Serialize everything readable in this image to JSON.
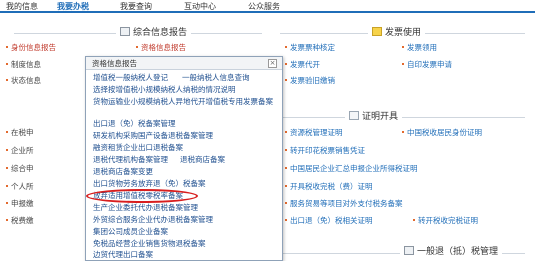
{
  "topnav": {
    "items": [
      {
        "label": "我的信息",
        "active": false
      },
      {
        "label": "我要办税",
        "active": true
      },
      {
        "label": "我要查询",
        "active": false
      },
      {
        "label": "互动中心",
        "active": false
      },
      {
        "label": "公众服务",
        "active": false
      }
    ]
  },
  "sections": {
    "comprehensive": {
      "title": "综合信息报告"
    },
    "invoice": {
      "title": "发票使用"
    },
    "certificate": {
      "title": "证明开具"
    },
    "general": {
      "title": "一般退（抵）税管理"
    }
  },
  "left_items": [
    "身份信息报告",
    "制度信息",
    "状态信息",
    "在税申",
    "企业所",
    "综合申",
    "个人所",
    "申报缴",
    "税费缴"
  ],
  "comprehensive_items": [
    "资格信息报告"
  ],
  "invoice_items": {
    "col1": [
      "发票票种核定",
      "发票代开",
      "发票验旧缴销"
    ],
    "col2": [
      "发票领用",
      "自印发票申请"
    ]
  },
  "right_items": {
    "col1": [
      "资源税管理证明",
      "转开印花税票销售凭证",
      "开具税收完税（费）证明",
      "服务贸易等项目对外支付税务备案",
      "出口退（免）税相关证明"
    ],
    "col2": [
      "中国税收居民身份证明",
      "转开税收完税证明"
    ],
    "full": [
      "中国居民企业汇总申报企业所得税证明"
    ]
  },
  "popup": {
    "title": "资格信息报告",
    "close": "×",
    "items": [
      "增值税一般纳税人登记",
      "一般纳税人信息查询",
      "选择按增值税小规模纳税人纳税的情况说明",
      "货物运输业小规模纳税人异地代开增值税专用发票备案",
      "出口退（免）税备案管理",
      "研发机构采购国产设备退税备案管理",
      "融资租赁企业出口退税备案",
      "退税代理机构备案管理",
      "退税商店备案",
      "退税商店备案变更",
      "出口货物劳务放弃退（免）税备案",
      "放弃适用增值税零税率备案",
      "生产企业委托代办退税备案管理",
      "外贸综合服务企业代办退税备案管理",
      "集团公司成员企业备案",
      "免税品经营企业销售货物退税备案",
      "边贸代理出口备案"
    ]
  }
}
